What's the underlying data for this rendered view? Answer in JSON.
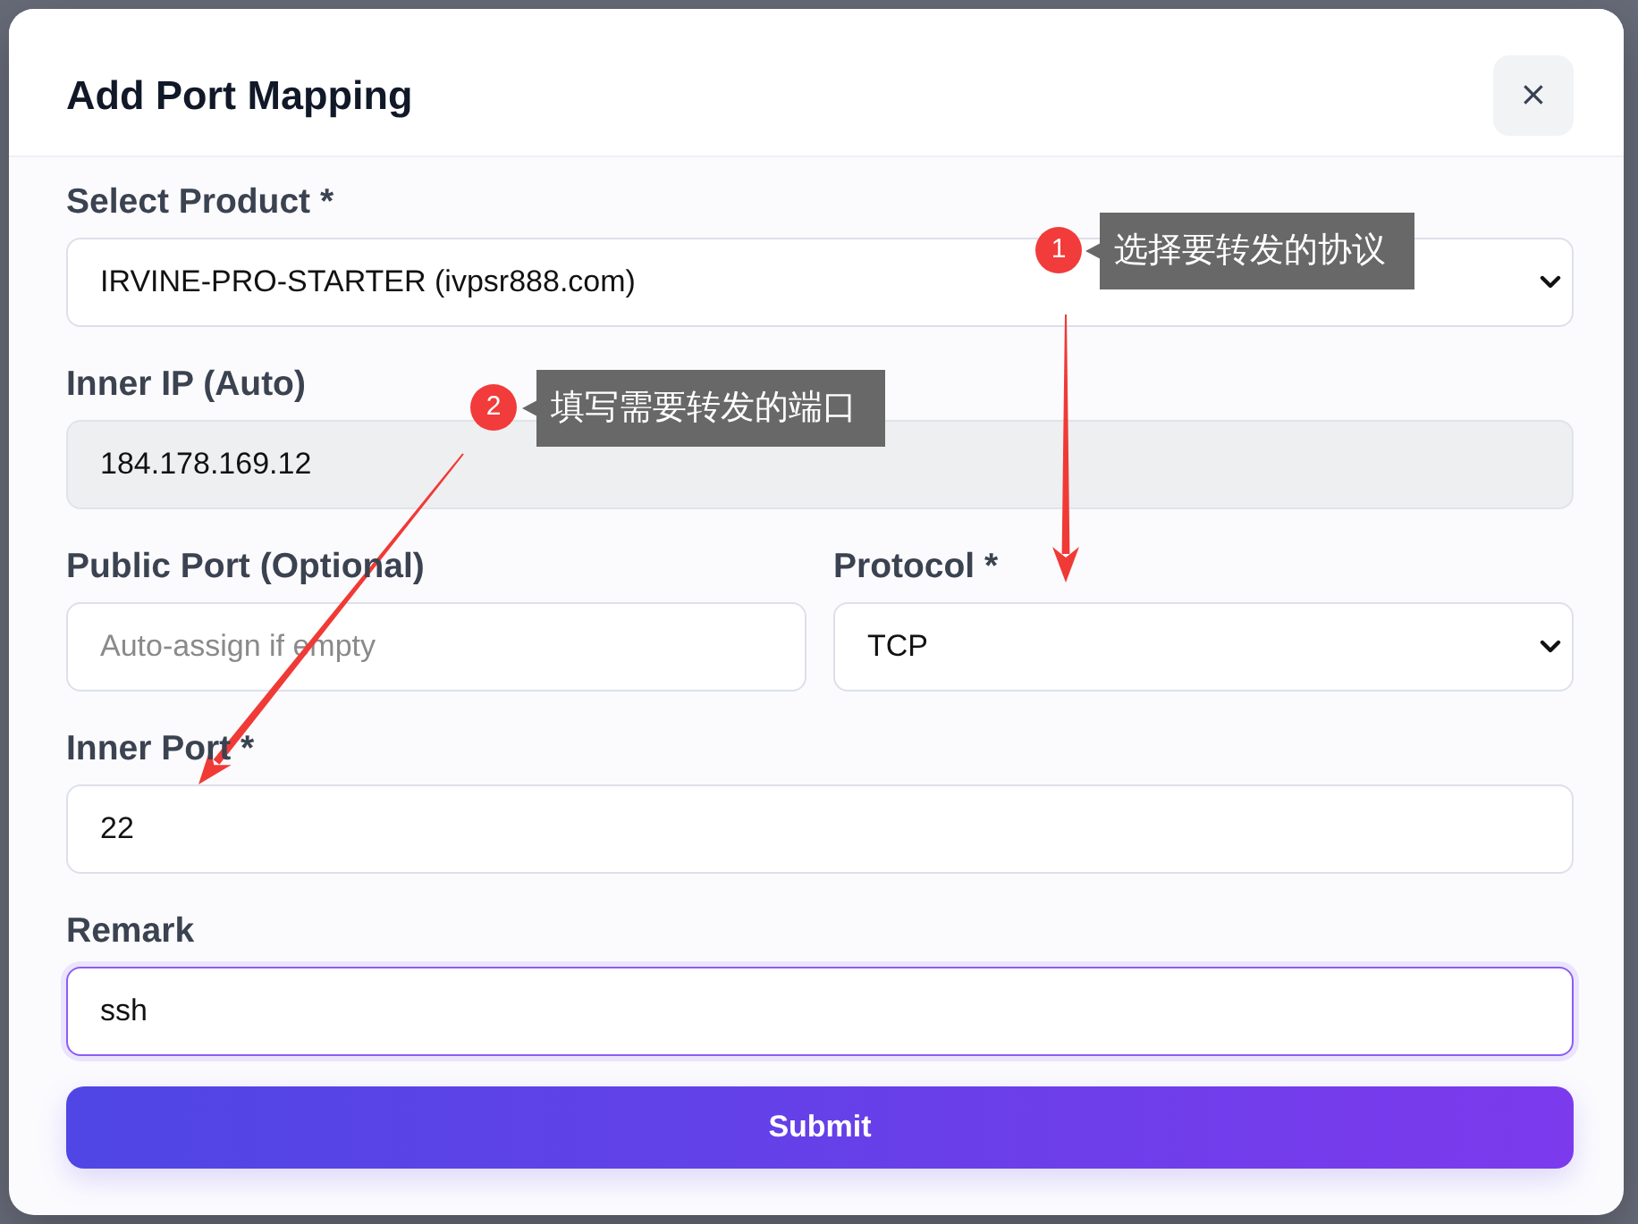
{
  "dialog": {
    "title": "Add Port Mapping",
    "close": "×"
  },
  "form": {
    "rows": [
      {
        "fields": [
          {
            "kind": "select",
            "label": "Select Product *",
            "value": "IRVINE-PRO-STARTER (ivpsr888.com)",
            "disabled": false,
            "focused": false
          }
        ]
      },
      {
        "fields": [
          {
            "kind": "input",
            "label": "Inner IP (Auto)",
            "value": "184.178.169.12",
            "disabled": true,
            "focused": false
          }
        ]
      },
      {
        "fields": [
          {
            "kind": "input",
            "label": "Public Port (Optional)",
            "placeholder": "Auto-assign if empty",
            "disabled": false,
            "focused": false
          },
          {
            "kind": "select",
            "label": "Protocol *",
            "value": "TCP",
            "disabled": false,
            "focused": false
          }
        ]
      },
      {
        "fields": [
          {
            "kind": "input",
            "label": "Inner Port *",
            "value": "22",
            "disabled": false,
            "focused": false
          }
        ]
      },
      {
        "fields": [
          {
            "kind": "input",
            "label": "Remark",
            "value": "ssh",
            "disabled": false,
            "focused": true
          }
        ]
      }
    ],
    "submit": "Submit"
  },
  "annotations": [
    {
      "number": "1",
      "text": "选择要转发的协议"
    },
    {
      "number": "2",
      "text": "填写需要转发的端口"
    }
  ]
}
